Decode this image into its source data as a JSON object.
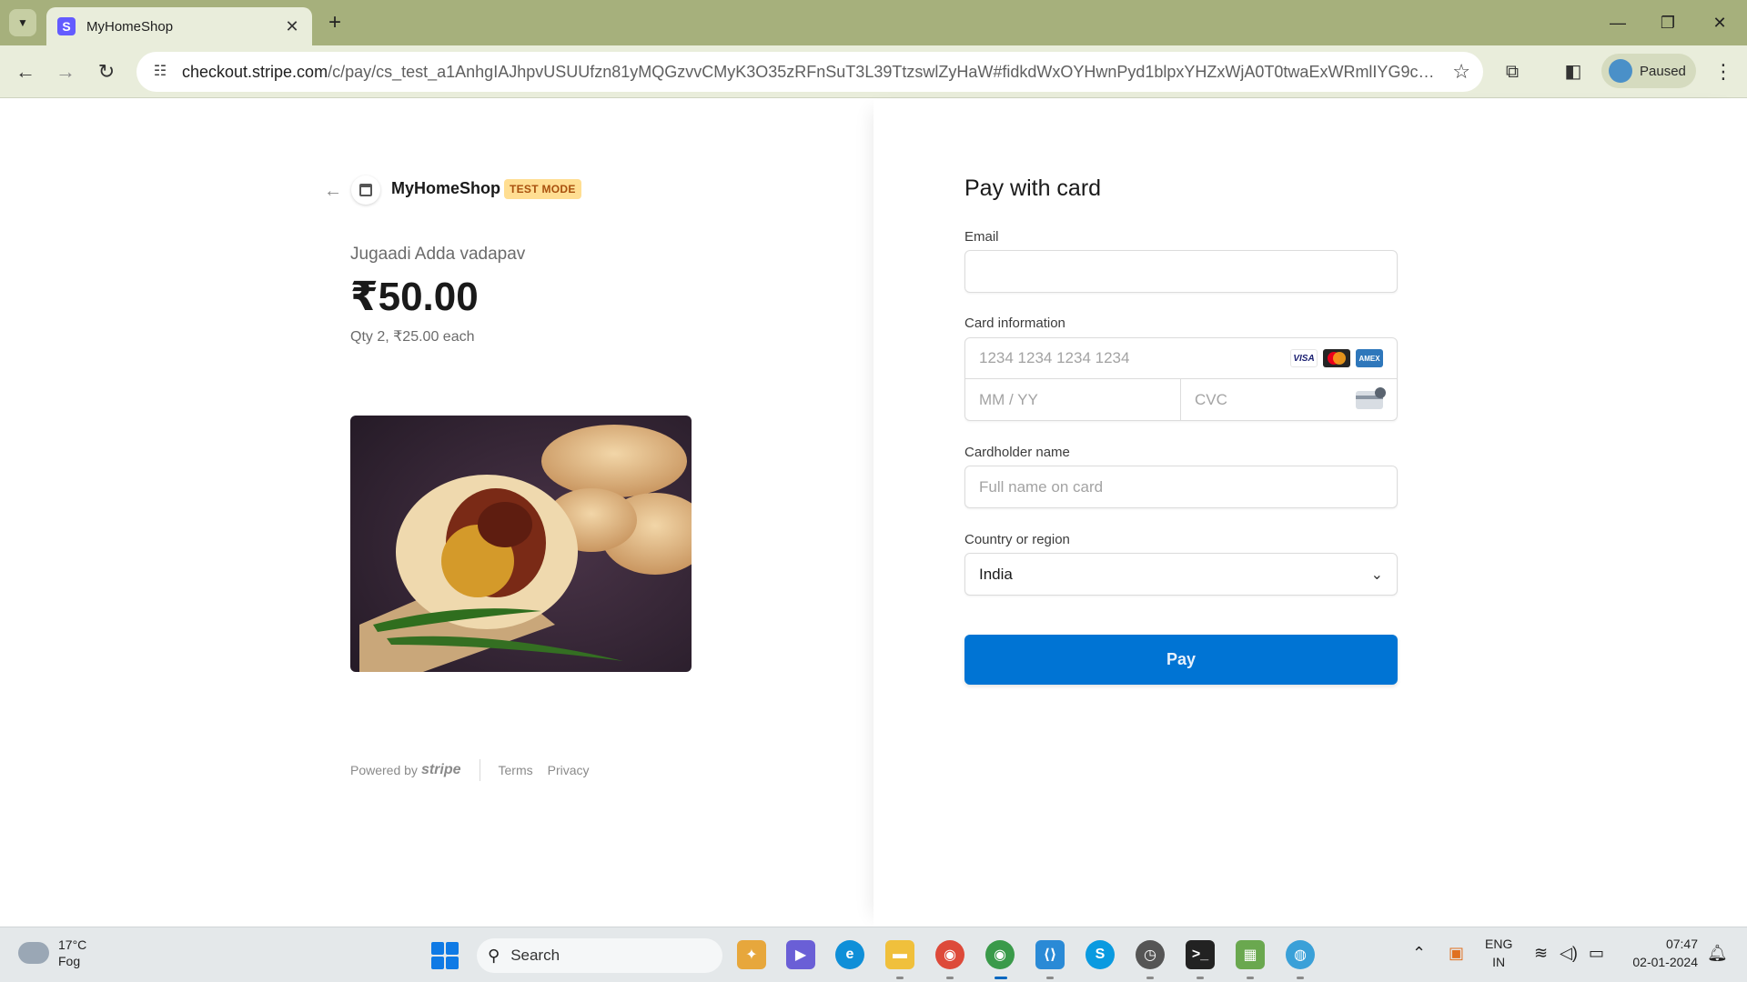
{
  "browser": {
    "tab_title": "MyHomeShop",
    "tab_favicon": "S",
    "url_domain": "checkout.stripe.com",
    "url_path": "/c/pay/cs_test_a1AnhgIAJhpvUSUUfzn81yMQGzvvCMyK3O35zRFnSuT3L39TtzswlZyHaW#fidkdWxOYHwnPyd1blpxYHZxWjA0T0twaExWRmlIYG9cZ3FGVmhmS...",
    "profile_label": "Paused",
    "accent": "#a6b07c"
  },
  "checkout": {
    "shop_name": "MyHomeShop",
    "test_badge": "TEST MODE",
    "product_name": "Jugaadi Adda vadapav",
    "price": "₹50.00",
    "qty_text": "Qty 2, ₹25.00 each",
    "footer": {
      "powered_by": "Powered by",
      "stripe": "stripe",
      "terms": "Terms",
      "privacy": "Privacy"
    }
  },
  "form": {
    "title": "Pay with card",
    "email_label": "Email",
    "email_value": "",
    "card_label": "Card information",
    "card_number_placeholder": "1234 1234 1234 1234",
    "card_brands": [
      "VISA",
      "mastercard",
      "AMEX"
    ],
    "exp_placeholder": "MM / YY",
    "cvc_placeholder": "CVC",
    "name_label": "Cardholder name",
    "name_placeholder": "Full name on card",
    "country_label": "Country or region",
    "country_value": "India",
    "pay_label": "Pay",
    "pay_color": "#0074d4"
  },
  "taskbar": {
    "temp": "17°C",
    "condition": "Fog",
    "search_label": "Search",
    "lang_top": "ENG",
    "lang_bottom": "IN",
    "time": "07:47",
    "date": "02-01-2024"
  }
}
